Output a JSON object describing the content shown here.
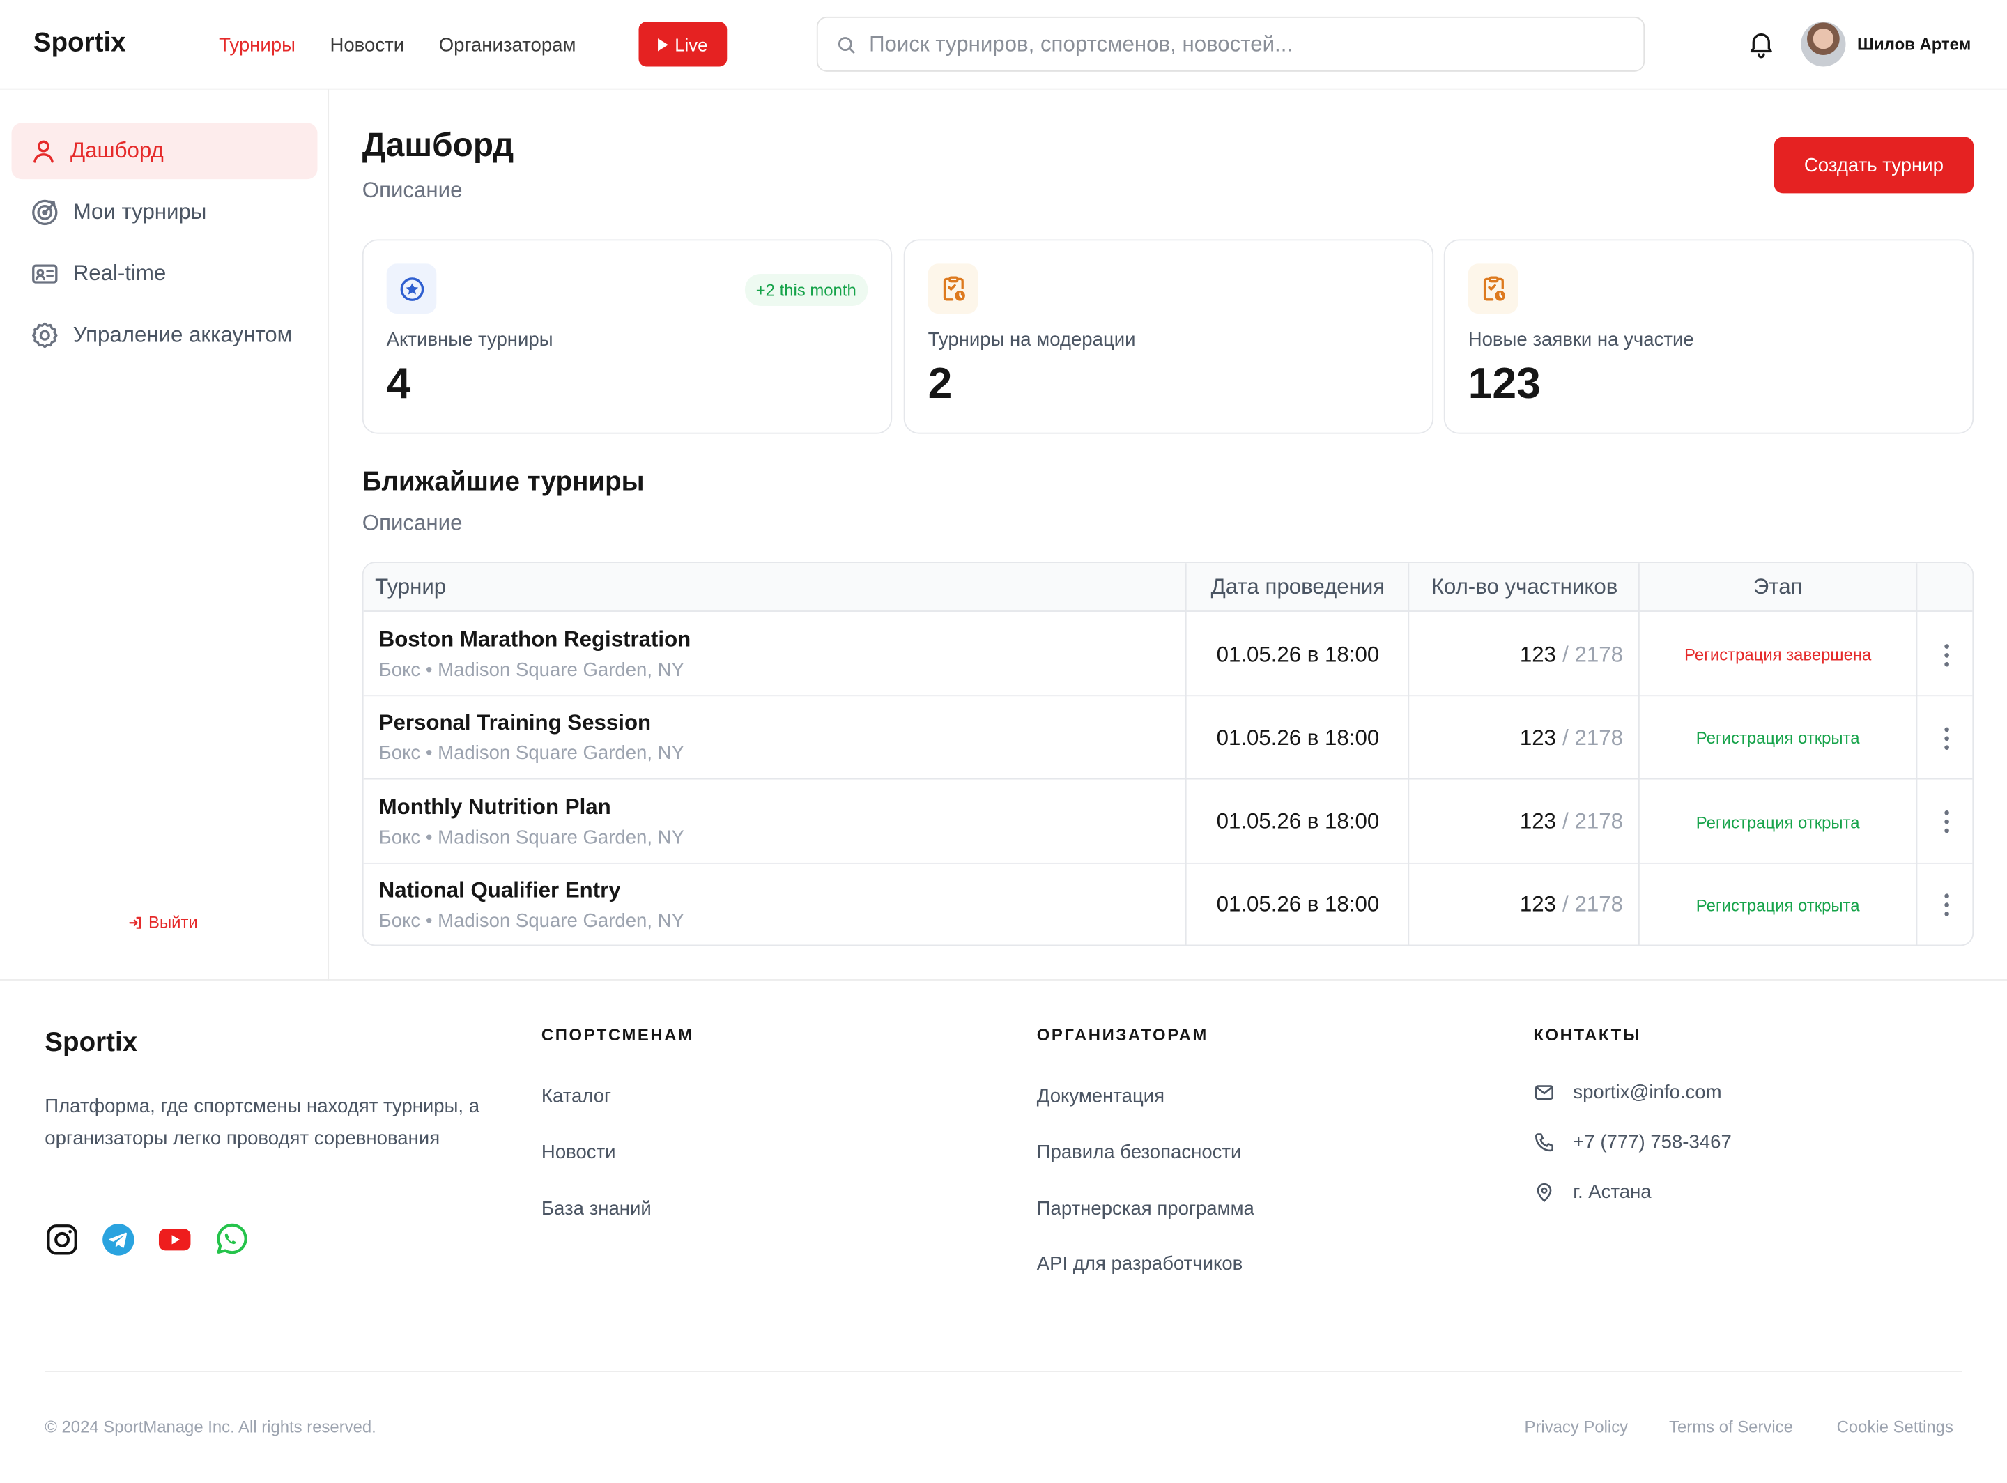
{
  "header": {
    "logo": "Sportix",
    "nav": [
      "Турниры",
      "Новости",
      "Организаторам"
    ],
    "live_label": "Live",
    "search_placeholder": "Поиск турниров, спортсменов, новостей...",
    "user_name": "Шилов Артем"
  },
  "sidebar": {
    "items": [
      {
        "label": "Дашборд",
        "icon": "user-icon",
        "active": true
      },
      {
        "label": "Мои турниры",
        "icon": "target-icon"
      },
      {
        "label": "Real-time",
        "icon": "id-card-icon"
      },
      {
        "label": "Упраление аккаунтом",
        "icon": "gear-icon"
      }
    ],
    "logout_label": "Выйти"
  },
  "main": {
    "title": "Дашборд",
    "subtitle": "Описание",
    "create_button": "Создать турнир",
    "stats": [
      {
        "label": "Активные турниры",
        "value": "4",
        "badge": "+2 this month",
        "icon": "star-badge-icon"
      },
      {
        "label": "Турниры на модерации",
        "value": "2",
        "icon": "clipboard-clock-icon"
      },
      {
        "label": "Новые заявки на участие",
        "value": "123",
        "icon": "clipboard-clock-icon"
      }
    ],
    "upcoming": {
      "title": "Ближайшие турниры",
      "subtitle": "Описание",
      "columns": [
        "Турнир",
        "Дата проведения",
        "Кол-во участников",
        "Этап"
      ],
      "rows": [
        {
          "name": "Boston Marathon Registration",
          "meta": "Бокс • Madison Square Garden, NY",
          "date": "01.05.26 в 18:00",
          "count": "123",
          "total": "/ 2178",
          "stage": "Регистрация завершена",
          "stage_color": "#e52a2a"
        },
        {
          "name": "Personal Training Session",
          "meta": "Бокс • Madison Square Garden, NY",
          "date": "01.05.26 в 18:00",
          "count": "123",
          "total": "/ 2178",
          "stage": "Регистрация открыта",
          "stage_color": "#16a34a"
        },
        {
          "name": "Monthly Nutrition Plan",
          "meta": "Бокс • Madison Square Garden, NY",
          "date": "01.05.26 в 18:00",
          "count": "123",
          "total": "/ 2178",
          "stage": "Регистрация открыта",
          "stage_color": "#16a34a"
        },
        {
          "name": "National Qualifier Entry",
          "meta": "Бокс • Madison Square Garden, NY",
          "date": "01.05.26 в 18:00",
          "count": "123",
          "total": "/ 2178",
          "stage": "Регистрация открыта",
          "stage_color": "#16a34a"
        }
      ]
    }
  },
  "footer": {
    "logo": "Sportix",
    "description": "Платформа, где спортсмены находят турниры, а организаторы легко проводят соревнования",
    "socials": [
      "instagram-icon",
      "telegram-icon",
      "youtube-icon",
      "whatsapp-icon"
    ],
    "athletes": {
      "title": "СПОРТСМЕНАМ",
      "links": [
        "Каталог",
        "Новости",
        "База знаний"
      ]
    },
    "organizers": {
      "title": "ОРГАНИЗАТОРАМ",
      "links": [
        "Документация",
        "Правила безопасности",
        "Партнерская программа",
        "API для разработчиков"
      ]
    },
    "contacts": {
      "title": "КОНТАКТЫ",
      "email": "sportix@info.com",
      "phone": "+7 (777) 758-3467",
      "city": "г. Астана"
    },
    "copyright": "© 2024 SportManage Inc. All rights reserved.",
    "legal": [
      "Privacy Policy",
      "Terms of Service",
      "Cookie Settings"
    ]
  },
  "colors": {
    "accent": "#e52222",
    "success": "#16a34a",
    "muted": "#9ca3af"
  }
}
